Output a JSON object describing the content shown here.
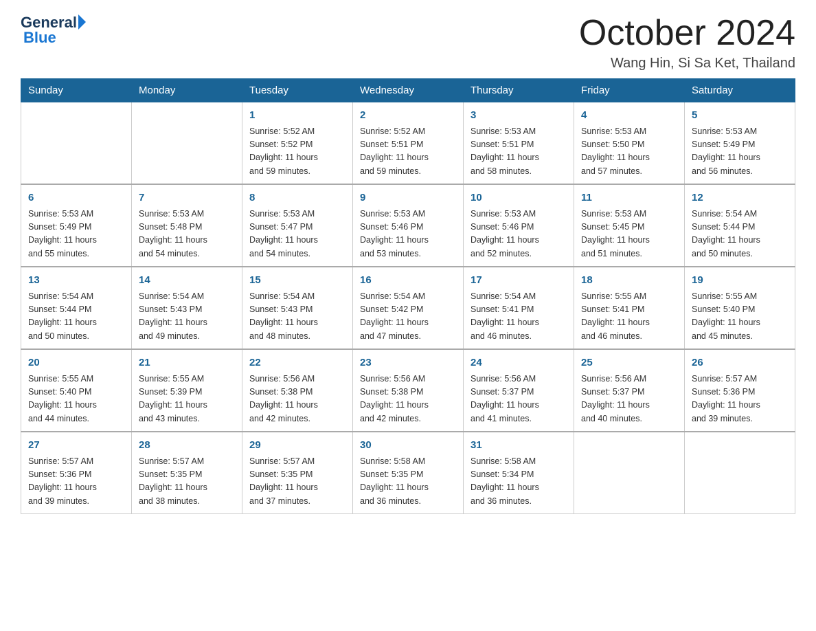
{
  "logo": {
    "general": "General",
    "blue": "Blue"
  },
  "title": "October 2024",
  "location": "Wang Hin, Si Sa Ket, Thailand",
  "days_of_week": [
    "Sunday",
    "Monday",
    "Tuesday",
    "Wednesday",
    "Thursday",
    "Friday",
    "Saturday"
  ],
  "weeks": [
    [
      {
        "day": "",
        "info": ""
      },
      {
        "day": "",
        "info": ""
      },
      {
        "day": "1",
        "info": "Sunrise: 5:52 AM\nSunset: 5:52 PM\nDaylight: 11 hours\nand 59 minutes."
      },
      {
        "day": "2",
        "info": "Sunrise: 5:52 AM\nSunset: 5:51 PM\nDaylight: 11 hours\nand 59 minutes."
      },
      {
        "day": "3",
        "info": "Sunrise: 5:53 AM\nSunset: 5:51 PM\nDaylight: 11 hours\nand 58 minutes."
      },
      {
        "day": "4",
        "info": "Sunrise: 5:53 AM\nSunset: 5:50 PM\nDaylight: 11 hours\nand 57 minutes."
      },
      {
        "day": "5",
        "info": "Sunrise: 5:53 AM\nSunset: 5:49 PM\nDaylight: 11 hours\nand 56 minutes."
      }
    ],
    [
      {
        "day": "6",
        "info": "Sunrise: 5:53 AM\nSunset: 5:49 PM\nDaylight: 11 hours\nand 55 minutes."
      },
      {
        "day": "7",
        "info": "Sunrise: 5:53 AM\nSunset: 5:48 PM\nDaylight: 11 hours\nand 54 minutes."
      },
      {
        "day": "8",
        "info": "Sunrise: 5:53 AM\nSunset: 5:47 PM\nDaylight: 11 hours\nand 54 minutes."
      },
      {
        "day": "9",
        "info": "Sunrise: 5:53 AM\nSunset: 5:46 PM\nDaylight: 11 hours\nand 53 minutes."
      },
      {
        "day": "10",
        "info": "Sunrise: 5:53 AM\nSunset: 5:46 PM\nDaylight: 11 hours\nand 52 minutes."
      },
      {
        "day": "11",
        "info": "Sunrise: 5:53 AM\nSunset: 5:45 PM\nDaylight: 11 hours\nand 51 minutes."
      },
      {
        "day": "12",
        "info": "Sunrise: 5:54 AM\nSunset: 5:44 PM\nDaylight: 11 hours\nand 50 minutes."
      }
    ],
    [
      {
        "day": "13",
        "info": "Sunrise: 5:54 AM\nSunset: 5:44 PM\nDaylight: 11 hours\nand 50 minutes."
      },
      {
        "day": "14",
        "info": "Sunrise: 5:54 AM\nSunset: 5:43 PM\nDaylight: 11 hours\nand 49 minutes."
      },
      {
        "day": "15",
        "info": "Sunrise: 5:54 AM\nSunset: 5:43 PM\nDaylight: 11 hours\nand 48 minutes."
      },
      {
        "day": "16",
        "info": "Sunrise: 5:54 AM\nSunset: 5:42 PM\nDaylight: 11 hours\nand 47 minutes."
      },
      {
        "day": "17",
        "info": "Sunrise: 5:54 AM\nSunset: 5:41 PM\nDaylight: 11 hours\nand 46 minutes."
      },
      {
        "day": "18",
        "info": "Sunrise: 5:55 AM\nSunset: 5:41 PM\nDaylight: 11 hours\nand 46 minutes."
      },
      {
        "day": "19",
        "info": "Sunrise: 5:55 AM\nSunset: 5:40 PM\nDaylight: 11 hours\nand 45 minutes."
      }
    ],
    [
      {
        "day": "20",
        "info": "Sunrise: 5:55 AM\nSunset: 5:40 PM\nDaylight: 11 hours\nand 44 minutes."
      },
      {
        "day": "21",
        "info": "Sunrise: 5:55 AM\nSunset: 5:39 PM\nDaylight: 11 hours\nand 43 minutes."
      },
      {
        "day": "22",
        "info": "Sunrise: 5:56 AM\nSunset: 5:38 PM\nDaylight: 11 hours\nand 42 minutes."
      },
      {
        "day": "23",
        "info": "Sunrise: 5:56 AM\nSunset: 5:38 PM\nDaylight: 11 hours\nand 42 minutes."
      },
      {
        "day": "24",
        "info": "Sunrise: 5:56 AM\nSunset: 5:37 PM\nDaylight: 11 hours\nand 41 minutes."
      },
      {
        "day": "25",
        "info": "Sunrise: 5:56 AM\nSunset: 5:37 PM\nDaylight: 11 hours\nand 40 minutes."
      },
      {
        "day": "26",
        "info": "Sunrise: 5:57 AM\nSunset: 5:36 PM\nDaylight: 11 hours\nand 39 minutes."
      }
    ],
    [
      {
        "day": "27",
        "info": "Sunrise: 5:57 AM\nSunset: 5:36 PM\nDaylight: 11 hours\nand 39 minutes."
      },
      {
        "day": "28",
        "info": "Sunrise: 5:57 AM\nSunset: 5:35 PM\nDaylight: 11 hours\nand 38 minutes."
      },
      {
        "day": "29",
        "info": "Sunrise: 5:57 AM\nSunset: 5:35 PM\nDaylight: 11 hours\nand 37 minutes."
      },
      {
        "day": "30",
        "info": "Sunrise: 5:58 AM\nSunset: 5:35 PM\nDaylight: 11 hours\nand 36 minutes."
      },
      {
        "day": "31",
        "info": "Sunrise: 5:58 AM\nSunset: 5:34 PM\nDaylight: 11 hours\nand 36 minutes."
      },
      {
        "day": "",
        "info": ""
      },
      {
        "day": "",
        "info": ""
      }
    ]
  ]
}
